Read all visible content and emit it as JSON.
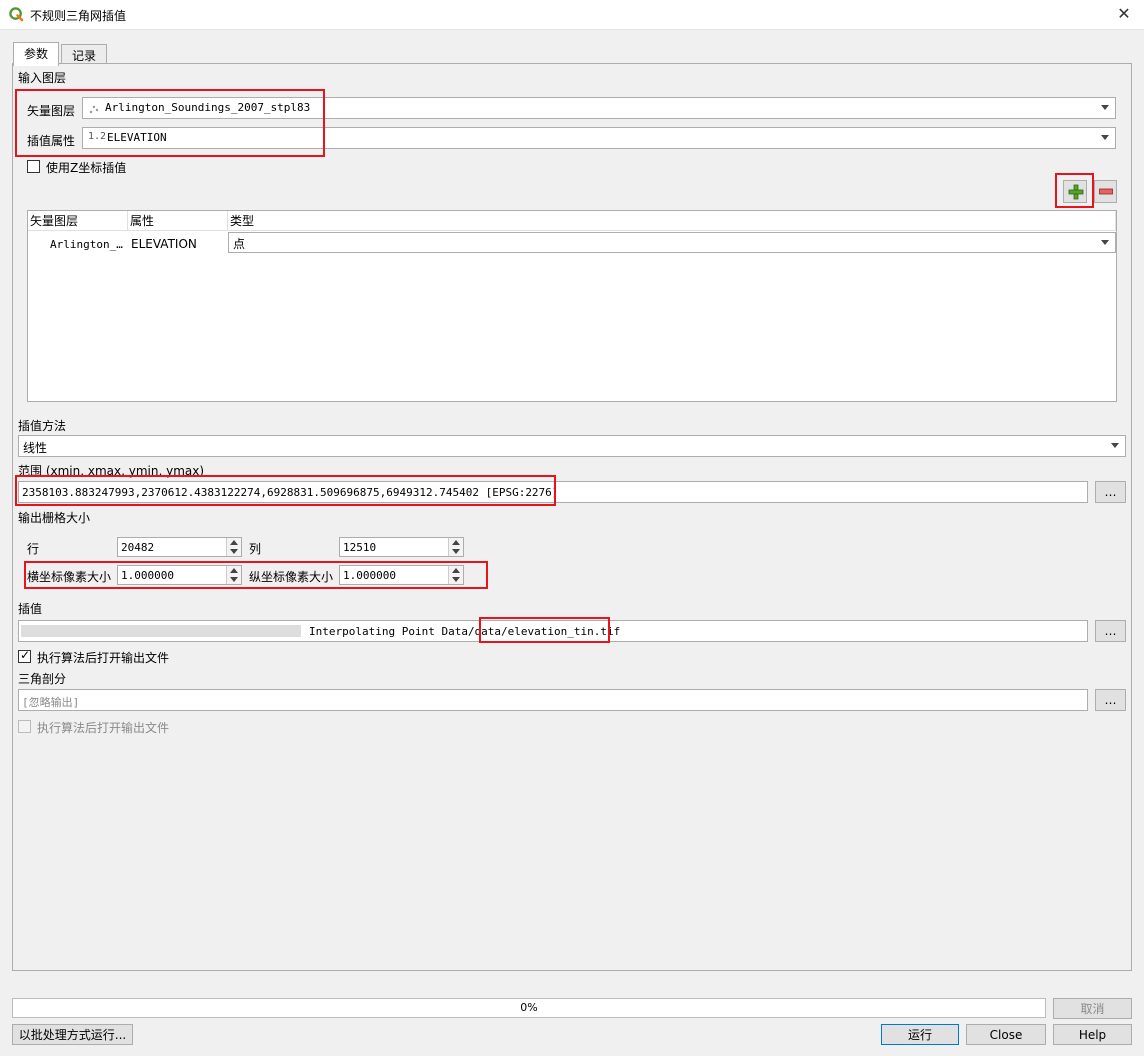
{
  "window": {
    "title": "不规则三角网插值",
    "close_glyph": "✕"
  },
  "tabs": [
    {
      "label": "参数"
    },
    {
      "label": "记录"
    }
  ],
  "input_layers": {
    "section_label": "输入图层",
    "vector_layer_label": "矢量图层",
    "vector_layer_value": "Arlington_Soundings_2007_stpl83",
    "attribute_label": "插值属性",
    "attribute_prefix": "1.2",
    "attribute_value": "ELEVATION",
    "use_z_label": "使用Z坐标插值",
    "add_glyph": "+",
    "remove_glyph": "−"
  },
  "layer_table": {
    "headers": [
      "矢量图层",
      "属性",
      "类型"
    ],
    "rows": [
      {
        "layer": "Arlington_…",
        "attribute": "ELEVATION",
        "type": "点"
      }
    ]
  },
  "interpolation": {
    "label": "插值方法",
    "value": "线性"
  },
  "extent": {
    "label": "范围 (xmin, xmax, ymin, ymax)",
    "value": "2358103.883247993,2370612.4383122274,6928831.509696875,6949312.745402 [EPSG:2276]",
    "browse": "…"
  },
  "raster_size": {
    "label": "输出栅格大小",
    "rows_label": "行",
    "rows_value": "20482",
    "cols_label": "列",
    "cols_value": "12510",
    "pixel_x_label": "横坐标像素大小",
    "pixel_x_value": "1.000000",
    "pixel_y_label": "纵坐标像素大小",
    "pixel_y_value": "1.000000"
  },
  "output": {
    "label": "插值",
    "path_visible": "Interpolating Point Data/data/elevation_tin.tif",
    "browse": "…",
    "open_after_label": "执行算法后打开输出文件",
    "check_glyph": "✓"
  },
  "triangulation": {
    "label": "三角剖分",
    "placeholder": "[忽略输出]",
    "browse": "…",
    "open_after_label": "执行算法后打开输出文件"
  },
  "progress": {
    "value": 0,
    "text": "0%"
  },
  "buttons": {
    "cancel": "取消",
    "batch": "以批处理方式运行...",
    "run": "运行",
    "close": "Close",
    "help": "Help"
  }
}
